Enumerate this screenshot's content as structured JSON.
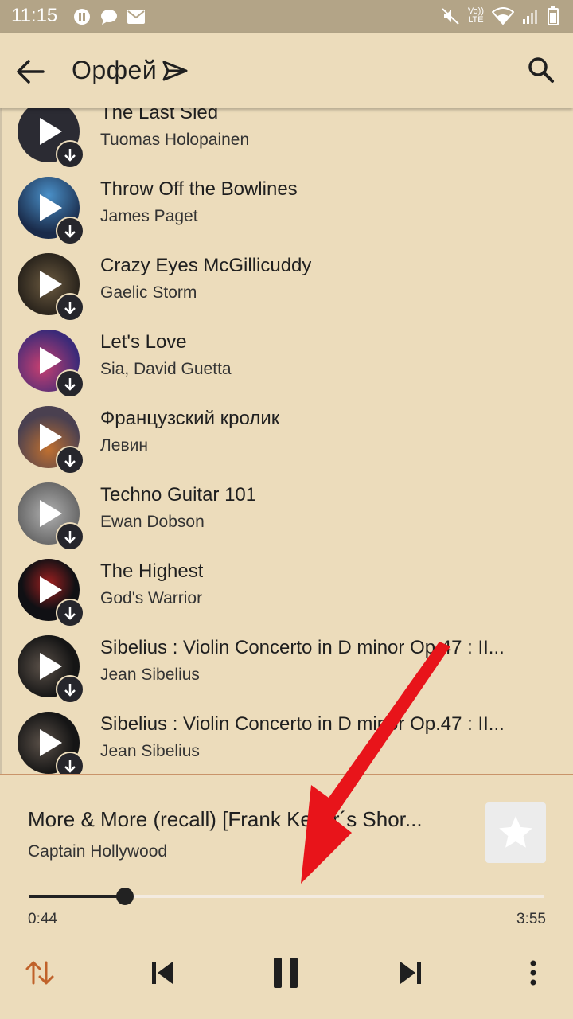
{
  "status_bar": {
    "time": "11:15",
    "lte_top": "Vo))",
    "lte_bottom": "LTE"
  },
  "app_bar": {
    "title": "Орфей",
    "back_icon": "arrow-left-icon",
    "search_icon": "search-icon"
  },
  "tracks": [
    {
      "title": "The Last Sled",
      "artist": "Tuomas Holopainen",
      "cover_color": "#2b2b33"
    },
    {
      "title": "Throw Off the Bowlines",
      "artist": "James Paget",
      "cover_color": "#1a2b4a"
    },
    {
      "title": "Crazy Eyes McGillicuddy",
      "artist": "Gaelic Storm",
      "cover_color": "#3d3428"
    },
    {
      "title": "Let's Love",
      "artist": "Sia, David Guetta",
      "cover_color": "#3b2a78"
    },
    {
      "title": "Французский кролик",
      "artist": "Левин",
      "cover_color": "#4a4050"
    },
    {
      "title": "Techno Guitar 101",
      "artist": "Ewan Dobson",
      "cover_color": "#8a8a8a"
    },
    {
      "title": "The Highest",
      "artist": "God's Warrior",
      "cover_color": "#101014"
    },
    {
      "title": "Sibelius : Violin Concerto in D minor Op.47 : II...",
      "artist": "Jean Sibelius",
      "cover_color": "#151515"
    },
    {
      "title": "Sibelius : Violin Concerto in D minor Op.47 : II...",
      "artist": "Jean Sibelius",
      "cover_color": "#151515"
    }
  ],
  "now_playing": {
    "title": "More & More (recall) [Frank Keller´s Shor...",
    "artist": "Captain Hollywood",
    "elapsed": "0:44",
    "duration": "3:55",
    "progress": 0.187
  },
  "controls": [
    "shuffle-order-icon",
    "previous-icon",
    "pause-icon",
    "next-icon",
    "more-vert-icon"
  ],
  "colors": {
    "background": "#ecdcbb",
    "status_bar": "#b3a487",
    "accent": "#c0622a",
    "annotation_arrow": "#e8141a"
  }
}
